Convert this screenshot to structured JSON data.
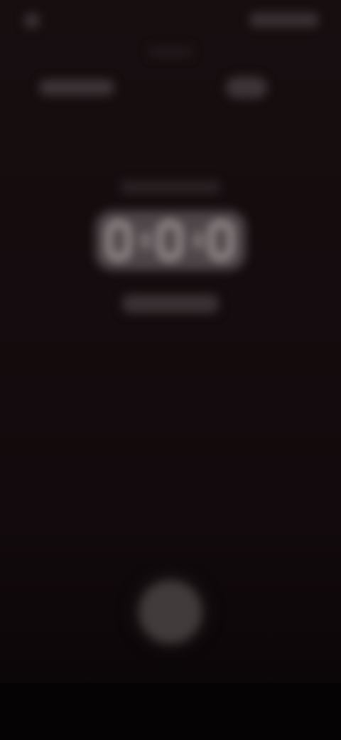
{
  "status_bar": {
    "time": "",
    "right_indicators": ""
  },
  "header": {
    "left_label": "",
    "right_icon": "more-icon"
  },
  "timer": {
    "caption": "",
    "digits": [
      "0",
      "0",
      "0"
    ],
    "subtitle": ""
  },
  "controls": {
    "record_icon": "record-icon"
  },
  "colors": {
    "background": "#120b0d",
    "digit_ring": "#b3aaab"
  }
}
